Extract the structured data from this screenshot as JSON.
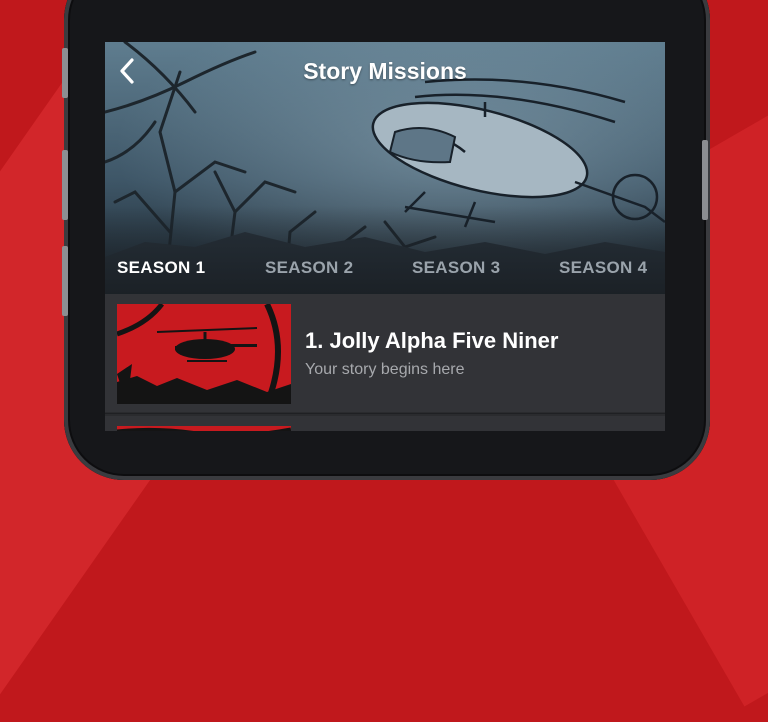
{
  "screen": {
    "title": "Story Missions",
    "back_icon": "chevron-left-icon"
  },
  "tabs": [
    {
      "label": "SEASON 1",
      "active": true
    },
    {
      "label": "SEASON 2",
      "active": false
    },
    {
      "label": "SEASON 3",
      "active": false
    },
    {
      "label": "SEASON 4",
      "active": false
    }
  ],
  "missions": [
    {
      "name": "1. Jolly Alpha Five Niner",
      "subtitle": "Your story begins here"
    }
  ],
  "colors": {
    "background_red": "#c0181c",
    "thumbnail_red": "#c81a1f",
    "active_tab": "#ffffff",
    "inactive_tab": "#9aa3ab"
  }
}
